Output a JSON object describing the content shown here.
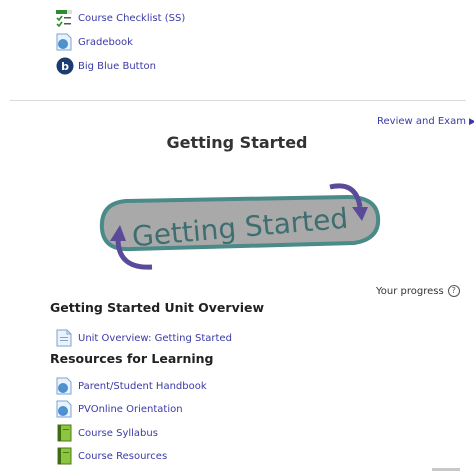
{
  "top_links": [
    {
      "label": "Course Checklist (SS)",
      "icon": "checklist-icon"
    },
    {
      "label": "Gradebook",
      "icon": "page-globe-icon"
    },
    {
      "label": "Big Blue Button",
      "icon": "bigbluebutton-icon"
    }
  ],
  "nav": {
    "next_label": "Review and Exam"
  },
  "section": {
    "title": "Getting Started",
    "banner_text": "Getting Started",
    "progress_label": "Your progress",
    "help_glyph": "?"
  },
  "overview": {
    "heading": "Getting Started Unit Overview",
    "items": [
      {
        "label": "Unit Overview: Getting Started",
        "icon": "page-icon"
      }
    ]
  },
  "resources": {
    "heading": "Resources for Learning",
    "items": [
      {
        "label": "Parent/Student Handbook",
        "icon": "page-globe-icon"
      },
      {
        "label": "PVOnline Orientation",
        "icon": "page-globe-icon"
      },
      {
        "label": "Course Syllabus",
        "icon": "book-icon"
      },
      {
        "label": "Course Resources",
        "icon": "book-icon"
      }
    ]
  },
  "colors": {
    "link": "#3a3aa8",
    "banner_fill": "#a9a9a9",
    "banner_border": "#4a8a88",
    "arrow": "#5b4a9a",
    "banner_text": "#3e6e70"
  }
}
